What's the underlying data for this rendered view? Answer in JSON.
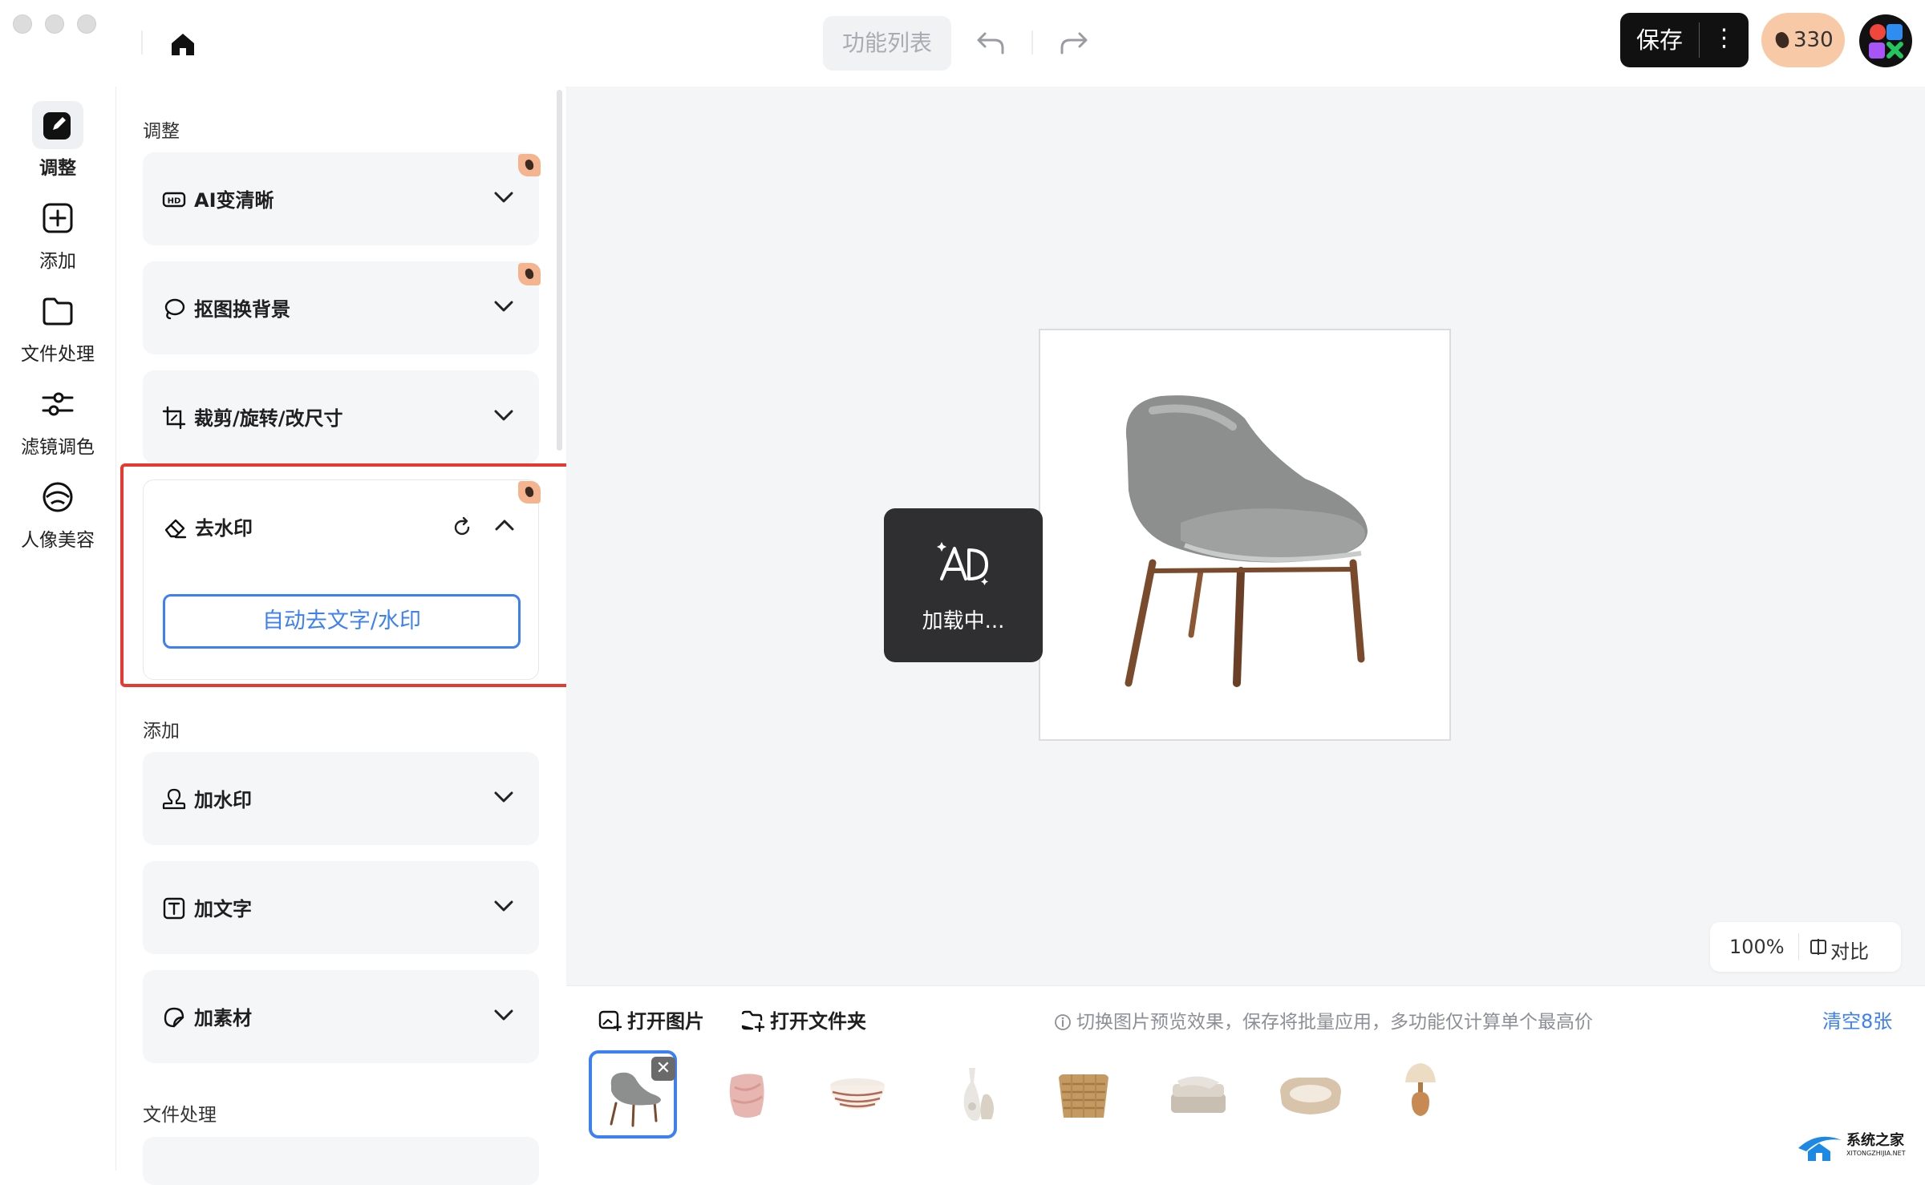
{
  "toolbar": {
    "feature_list": "功能列表",
    "save": "保存",
    "more": "⋮",
    "credits": "330"
  },
  "nav": [
    {
      "label": "调整",
      "icon": "edit-icon",
      "active": true
    },
    {
      "label": "添加",
      "icon": "plus-square-icon"
    },
    {
      "label": "文件处理",
      "icon": "folder-icon"
    },
    {
      "label": "滤镜调色",
      "icon": "sliders-icon"
    },
    {
      "label": "人像美容",
      "icon": "face-icon"
    }
  ],
  "panel": {
    "section_adjust": "调整",
    "ai_clear": "AI变清晰",
    "cutout": "抠图换背景",
    "crop": "裁剪/旋转/改尺寸",
    "remove_watermark": "去水印",
    "auto_remove": "自动去文字/水印",
    "section_add": "添加",
    "add_watermark": "加水印",
    "add_text": "加文字",
    "add_material": "加素材",
    "section_file": "文件处理"
  },
  "canvas": {
    "loading": "加载中...",
    "zoom": "100%",
    "compare": "对比"
  },
  "bottom": {
    "open_image": "打开图片",
    "open_folder": "打开文件夹",
    "hint": "切换图片预览效果，保存将批量应用，多功能仅计算单个最高价",
    "clear": "清空8张",
    "thumbnails": [
      "chair",
      "pink-vase",
      "striped-bowl",
      "white-vases",
      "wicker-basket",
      "folded-blanket",
      "pet-bed",
      "table-lamp"
    ]
  },
  "branding": {
    "site_cn": "系统之家",
    "site_en": "XITONGZHIJIA.NET"
  },
  "colors": {
    "accent": "#3d7ff5",
    "highlight": "#e8382f",
    "badge": "#f3b48f"
  }
}
